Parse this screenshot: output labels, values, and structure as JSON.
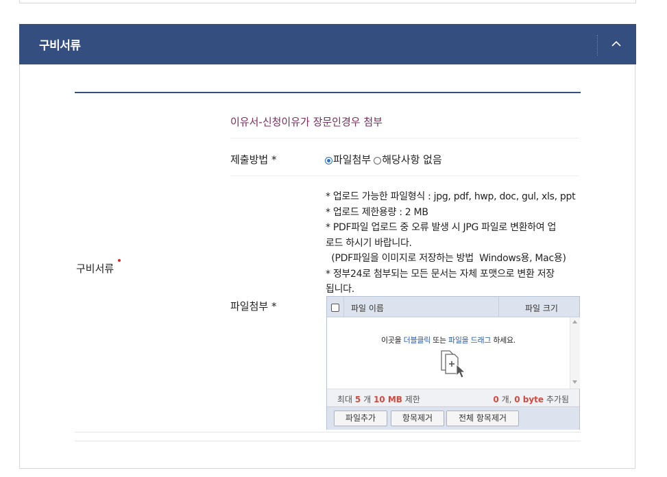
{
  "section": {
    "title": "구비서류"
  },
  "document": {
    "label": "구비서류",
    "title": "이유서-신청이유가 장문인경우 첨부",
    "submit_method_label": "제출방법 *",
    "options": [
      {
        "label": "파일첨부",
        "selected": true
      },
      {
        "label": "해당사항 없음",
        "selected": false
      }
    ],
    "attach_label": "파일첨부 *",
    "notes": [
      "* 업로드 가능한 파일형식 : jpg, pdf, hwp, doc, gul, xls, ppt",
      "* 업로드 제한용량 : 2 MB",
      "* PDF파일 업로드 중 오류 발생 시 JPG 파일로 변환하여 업",
      "로드 하시기 바랍니다.",
      "  (PDF파일을 이미지로 저장하는 방법  Windows용, Mac용)",
      "* 정부24로 첨부되는 모든 문서는 자체 포맷으로 변환 저장",
      "됩니다."
    ]
  },
  "uploader": {
    "col_name": "파일 이름",
    "col_size": "파일 크기",
    "drop_text_1": "이곳을 ",
    "drop_link_1": "더블클릭",
    "drop_text_2": " 또는 ",
    "drop_link_2": "파일을 드래그",
    "drop_text_3": " 하세요.",
    "limit_prefix": "최대 ",
    "limit_count": "5",
    "limit_mid": " 개 ",
    "limit_size": "10 MB",
    "limit_suffix": " 제한",
    "added_count": "0",
    "added_mid": " 개, ",
    "added_size": "0 byte",
    "added_suffix": " 추가됨",
    "buttons": {
      "add": "파일추가",
      "remove": "항목제거",
      "remove_all": "전체 항목제거"
    }
  },
  "colors": {
    "header_bg": "#344f7f",
    "title_purple": "#7a2b5c",
    "link_blue": "#2a5aa8",
    "status_red": "#d24a3f"
  },
  "icons": {
    "collapse": "chevron-up-icon",
    "drop": "file-add-icon",
    "required": "required-dot-icon"
  }
}
